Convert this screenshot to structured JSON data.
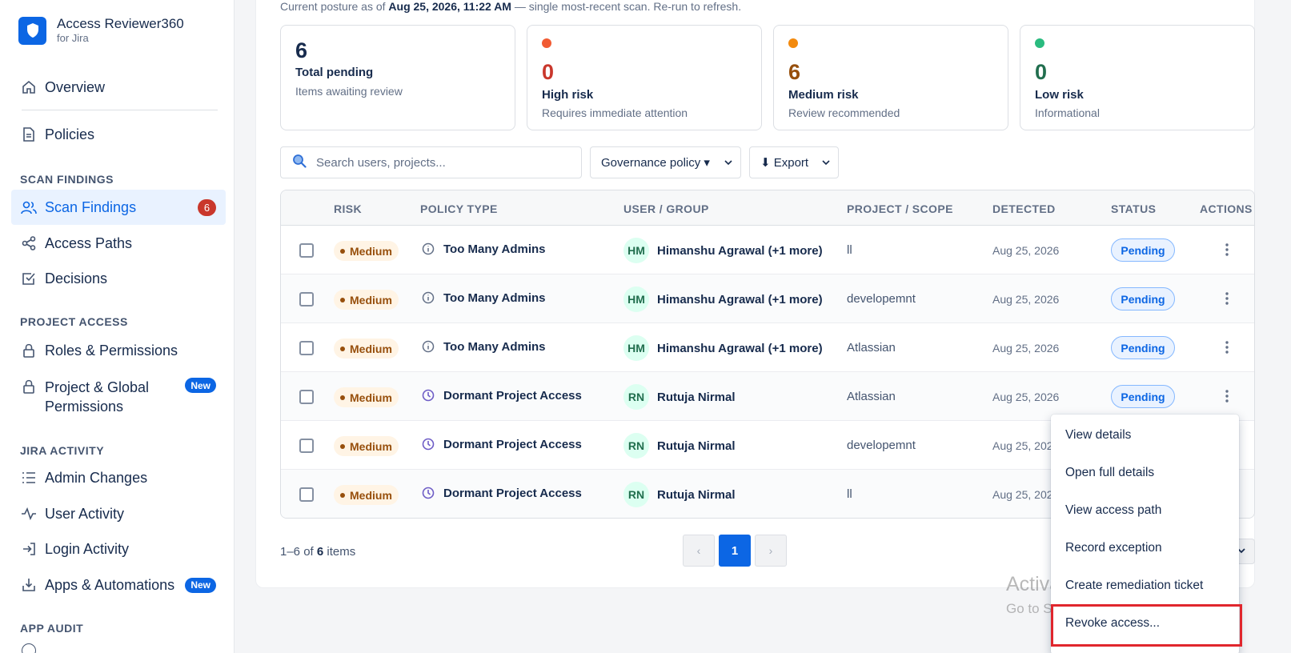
{
  "app": {
    "title": "Access Reviewer360",
    "subtitle": "for Jira"
  },
  "sidebar": {
    "overview": "Overview",
    "policies": "Policies",
    "sections": {
      "scan_findings": "SCAN FINDINGS",
      "project_access": "PROJECT ACCESS",
      "jira_activity": "JIRA ACTIVITY",
      "app_audit": "APP AUDIT"
    },
    "scan_findings": "Scan Findings",
    "scan_findings_count": "6",
    "access_paths": "Access Paths",
    "decisions": "Decisions",
    "roles_permissions": "Roles & Permissions",
    "project_global_line1": "Project & Global",
    "project_global_line2": "Permissions",
    "admin_changes": "Admin Changes",
    "user_activity": "User Activity",
    "login_activity": "Login Activity",
    "apps_automations": "Apps & Automations",
    "new_badge": "New"
  },
  "posture": {
    "prefix": "Current posture as of ",
    "timestamp": "Aug 25, 2026, 11:22 AM",
    "suffix": " — single most-recent scan. Re-run to refresh."
  },
  "stats": [
    {
      "value": "6",
      "label": "Total pending",
      "desc": "Items awaiting review",
      "color": "#172b4d"
    },
    {
      "value": "0",
      "label": "High risk",
      "desc": "Requires immediate attention",
      "color": "#c9372c",
      "dot": "#f15b33"
    },
    {
      "value": "6",
      "label": "Medium risk",
      "desc": "Review recommended",
      "color": "#974f0c",
      "dot": "#f38a0e"
    },
    {
      "value": "0",
      "label": "Low risk",
      "desc": "Informational",
      "color": "#216e4e",
      "dot": "#2abb7f"
    }
  ],
  "toolbar": {
    "search_placeholder": "Search users, projects...",
    "governance_select": "Governance policy ▾",
    "export_label": "⬇ Export"
  },
  "table": {
    "headers": {
      "risk": "RISK",
      "policy_type": "POLICY TYPE",
      "user_group": "USER / GROUP",
      "project_scope": "PROJECT / SCOPE",
      "detected": "DETECTED",
      "status": "STATUS",
      "actions": "ACTIONS"
    },
    "rows": [
      {
        "risk": "Medium",
        "policy": "Too Many Admins",
        "policy_icon": "info-icon",
        "initials": "HM",
        "user": "Himanshu Agrawal (+1 more)",
        "scope": "ll",
        "detected": "Aug 25, 2026",
        "status": "Pending"
      },
      {
        "risk": "Medium",
        "policy": "Too Many Admins",
        "policy_icon": "info-icon",
        "initials": "HM",
        "user": "Himanshu Agrawal (+1 more)",
        "scope": "developemnt",
        "detected": "Aug 25, 2026",
        "status": "Pending"
      },
      {
        "risk": "Medium",
        "policy": "Too Many Admins",
        "policy_icon": "info-icon",
        "initials": "HM",
        "user": "Himanshu Agrawal (+1 more)",
        "scope": "Atlassian",
        "detected": "Aug 25, 2026",
        "status": "Pending"
      },
      {
        "risk": "Medium",
        "policy": "Dormant Project Access",
        "policy_icon": "clock-icon",
        "initials": "RN",
        "user": "Rutuja Nirmal",
        "scope": "Atlassian",
        "detected": "Aug 25, 2026",
        "status": "Pending"
      },
      {
        "risk": "Medium",
        "policy": "Dormant Project Access",
        "policy_icon": "clock-icon",
        "initials": "RN",
        "user": "Rutuja Nirmal",
        "scope": "developemnt",
        "detected": "Aug 25, 202",
        "status": ""
      },
      {
        "risk": "Medium",
        "policy": "Dormant Project Access",
        "policy_icon": "clock-icon",
        "initials": "RN",
        "user": "Rutuja Nirmal",
        "scope": "ll",
        "detected": "Aug 25, 202",
        "status": ""
      }
    ]
  },
  "footer": {
    "range": "1–6 of ",
    "total": "6",
    "items": " items",
    "prev": "‹",
    "current_page": "1",
    "next": "›"
  },
  "action_menu": {
    "items": [
      "View details",
      "Open full details",
      "View access path",
      "Record exception",
      "Create remediation ticket",
      "Revoke access..."
    ]
  },
  "watermark": {
    "title": "Activate Windows",
    "subtitle": "Go to Settings to activate Windows."
  },
  "colors": {
    "accent": "#0c66e4",
    "medium": "#974f0c",
    "highlight_border": "#e0262d"
  }
}
